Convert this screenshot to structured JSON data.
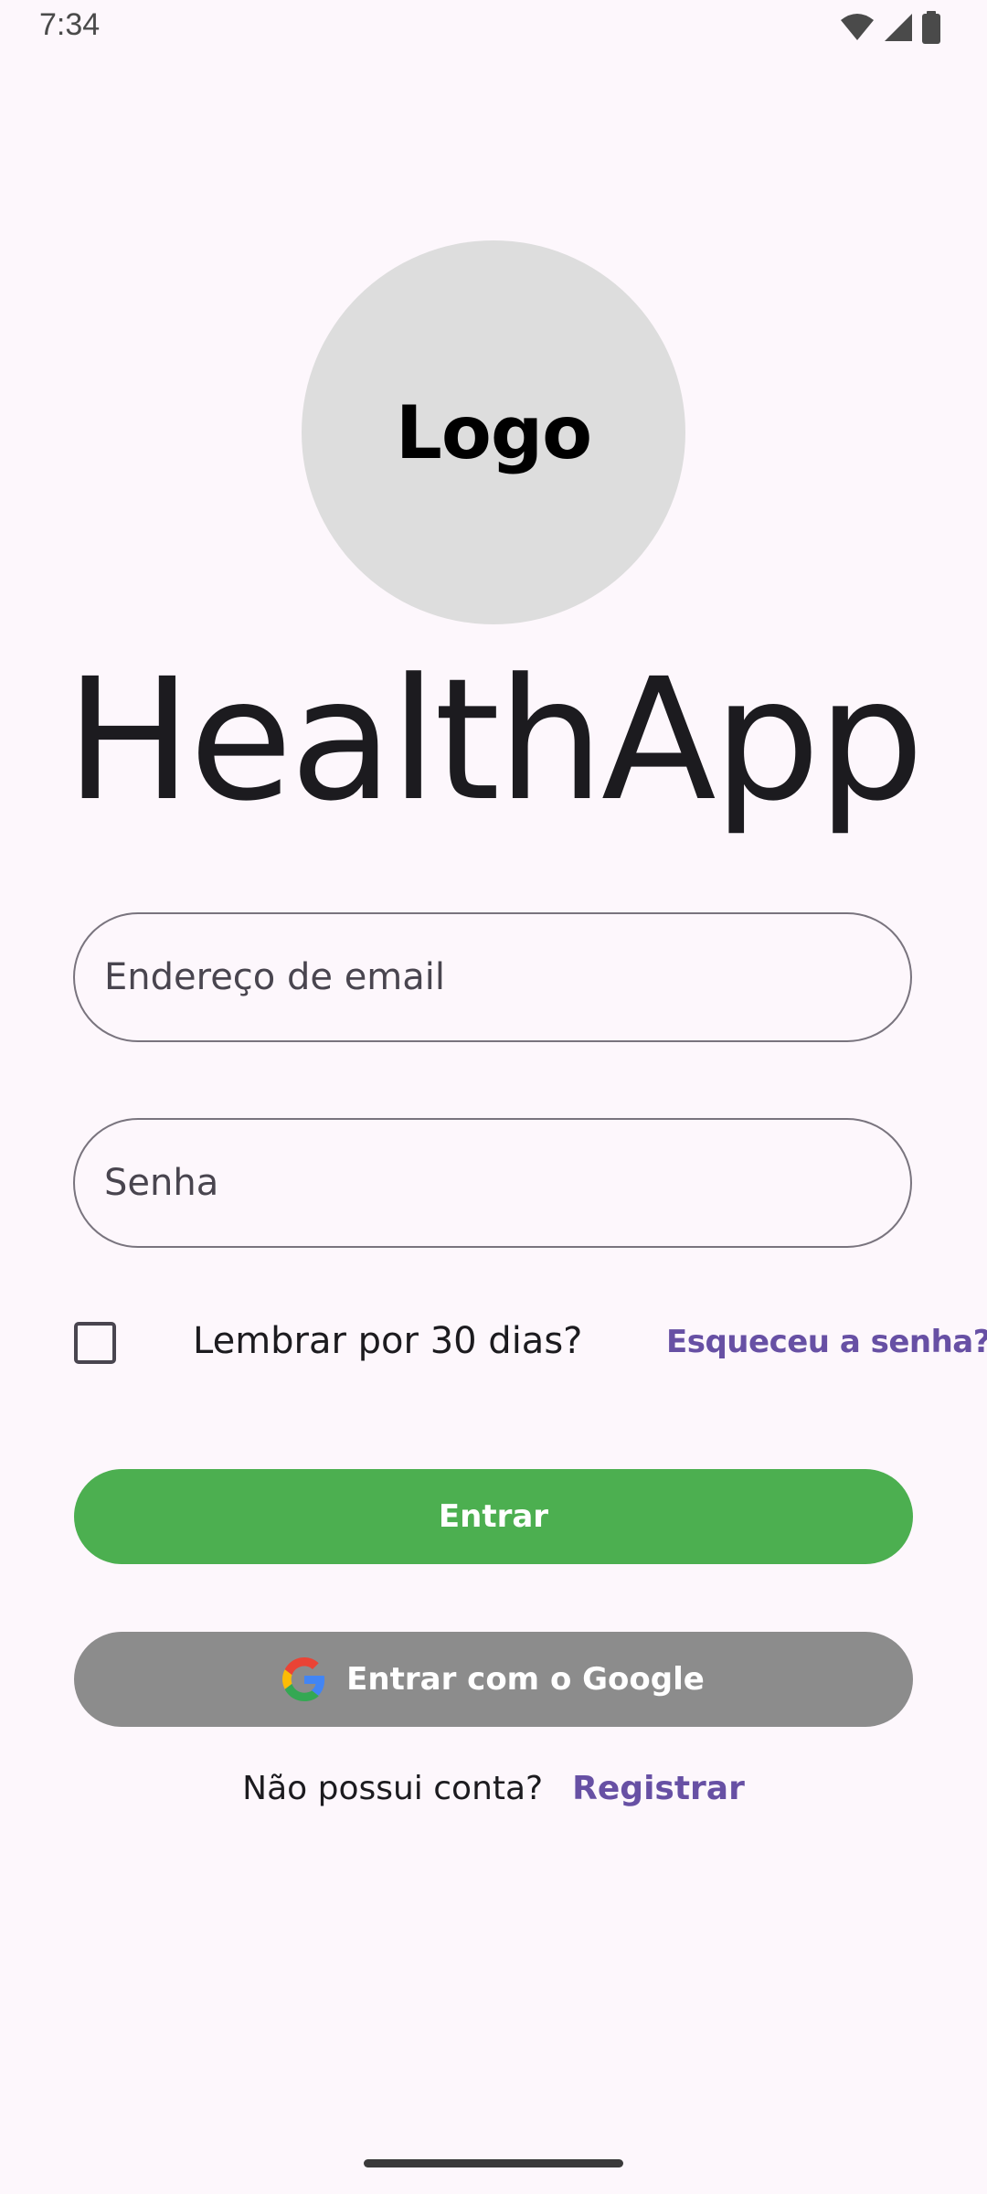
{
  "status_bar": {
    "time": "7:34",
    "icons": [
      "wifi-icon",
      "cellular-signal-icon",
      "battery-icon"
    ]
  },
  "logo": {
    "text": "Logo"
  },
  "app": {
    "title": "HealthApp"
  },
  "form": {
    "email_placeholder": "Endereço de email",
    "email_value": "",
    "password_placeholder": "Senha",
    "password_value": "",
    "remember_label": "Lembrar por 30 dias?",
    "remember_checked": false,
    "forgot_password": "Esqueceu a senha?"
  },
  "buttons": {
    "login": "Entrar",
    "google": "Entrar com o Google"
  },
  "register": {
    "prompt": "Não possui conta?",
    "link": "Registrar"
  },
  "colors": {
    "background": "#FDF7FC",
    "primary_green": "#4CAF50",
    "google_button_gray": "#8C8C8C",
    "link_purple": "#6750A4",
    "logo_circle": "#DDDDDD"
  }
}
